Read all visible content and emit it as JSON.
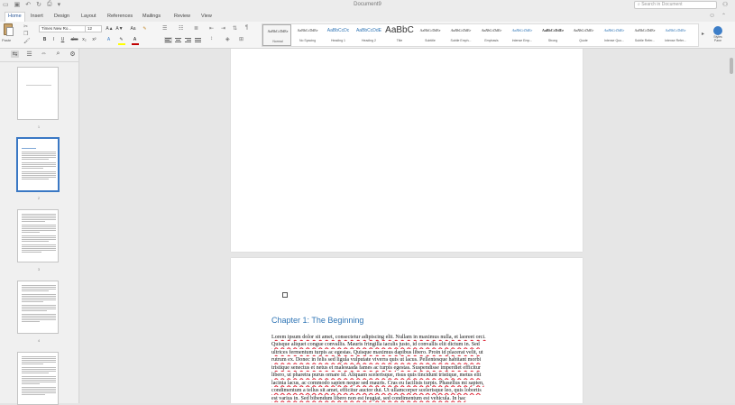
{
  "window": {
    "title": "Document9",
    "search_placeholder": "Search in Document",
    "quick_access": [
      "save-icon",
      "undo-icon",
      "redo-icon",
      "print-icon"
    ]
  },
  "tabs": [
    "Home",
    "Insert",
    "Design",
    "Layout",
    "References",
    "Mailings",
    "Review",
    "View"
  ],
  "ribbon": {
    "paste_label": "Paste",
    "font_name": "Times New Ro...",
    "font_size": "12",
    "format_buttons": [
      "B",
      "I",
      "U",
      "abc",
      "x₂",
      "x²"
    ],
    "increase_font": "A▲",
    "decrease_font": "A▼",
    "styles": [
      {
        "preview": "AaBbCcDdEe",
        "name": "Normal"
      },
      {
        "preview": "AaBbCcDdEe",
        "name": "No Spacing"
      },
      {
        "preview": "AaBbCcDc",
        "name": "Heading 1"
      },
      {
        "preview": "AaBbCcDdE",
        "name": "Heading 2"
      },
      {
        "preview": "AaBbC",
        "name": "Title"
      },
      {
        "preview": "AaBbCcDdEe",
        "name": "Subtitle"
      },
      {
        "preview": "AaBbCcDdEe",
        "name": "Subtle Emph..."
      },
      {
        "preview": "AaBbCcDdEe",
        "name": "Emphasis"
      },
      {
        "preview": "AaBbCcDdEe",
        "name": "Intense Emp..."
      },
      {
        "preview": "AaBbCcDdEe",
        "name": "Strong"
      },
      {
        "preview": "AaBbCcDdEe",
        "name": "Quote"
      },
      {
        "preview": "AaBbCcDdEe",
        "name": "Intense Quo..."
      },
      {
        "preview": "AaBbCcDdEe",
        "name": "Subtle Refer..."
      },
      {
        "preview": "AaBbCcDdEe",
        "name": "Intense Refer..."
      }
    ],
    "styles_pane_label": "Styles Pane",
    "font_color": "#c00000",
    "highlight_color": "#ffff00"
  },
  "nav_pane": {
    "tools": [
      "sidebar-toggle-icon",
      "list-icon",
      "thumbnails-icon",
      "search-icon",
      "settings-icon"
    ],
    "page_numbers": [
      "1",
      "2",
      "3",
      "4",
      "5"
    ],
    "selected_page": "2"
  },
  "document": {
    "chapter_title": "Chapter 1: The Beginning",
    "body_lines": [
      "Lorem ipsum dolor sit amet, consectetur adipiscing elit. Nullam in maximus nulla, et laoreet orci.",
      "Quisque aliquet congue convallis. Mauris fringilla iaculis justo, id convallis elit dictum in. Sed",
      "ultrices fermentum turpis ac egestas. Quisque maximus dapibus libero. Proin id placerat velit, ut",
      "rutrum ex. Donec in felis sed ligula vulputate viverra quis ut lacus. Pellentesque habitant morbi",
      "tristique senectus et netus et malesuada fames ac turpis egestas. Suspendisse imperdiet efficitur",
      "libero, ut pharetra purus ornare id. Aliquam scelerisque, risus quis tincidunt tristique, metus elit",
      "lacinia lacus, ac commodo sapien neque sed mauris. Cras eu facilisis turpis. Phasellus mi sapien,",
      "condimentum a tellus sit amet, efficitur auctor dui. Ut ullamcorper scelerisque leo, quis lobortis",
      "est varius in. Sed bibendum libero non est feugiat, sed condimentum est vehicula. In hac"
    ]
  }
}
